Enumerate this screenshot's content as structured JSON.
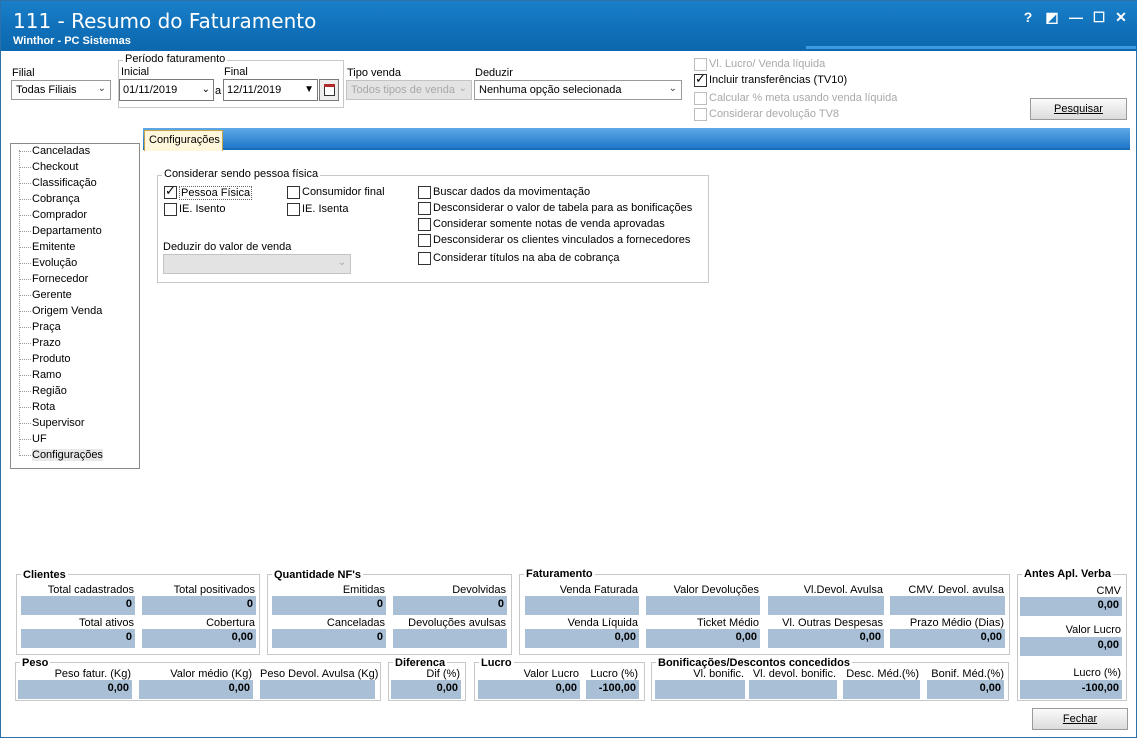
{
  "window": {
    "title": "111 - Resumo do Faturamento",
    "subtitle": "Winthor - PC Sistemas",
    "controls": [
      "?",
      "◩",
      "—",
      "☐",
      "✕"
    ]
  },
  "filters": {
    "filial_label": "Filial",
    "filial_value": "Todas Filiais",
    "periodo_label": "Período faturamento",
    "inicial_label": "Inicial",
    "inicial_value": "01/11/2019",
    "a_label": "a",
    "final_label": "Final",
    "final_value": "12/11/2019",
    "tipo_venda_label": "Tipo venda",
    "tipo_venda_value": "Todos tipos de venda",
    "deduzir_label": "Deduzir",
    "deduzir_value": "Nenhuma opção selecionada",
    "options": [
      {
        "label": "Vl. Lucro/ Venda líquida",
        "checked": false,
        "disabled": true
      },
      {
        "label": "Incluir transferências  (TV10)",
        "checked": true,
        "disabled": false
      },
      {
        "label": "Calcular % meta usando venda líquida",
        "checked": false,
        "disabled": true
      },
      {
        "label": "Considerar devolução TV8",
        "checked": false,
        "disabled": true
      }
    ],
    "pesquisar_button": "Pesquisar"
  },
  "tree": {
    "items": [
      "Canceladas",
      "Checkout",
      "Classificação",
      "Cobrança",
      "Comprador",
      "Departamento",
      "Emitente",
      "Evolução",
      "Fornecedor",
      "Gerente",
      "Origem Venda",
      "Praça",
      "Prazo",
      "Produto",
      "Ramo",
      "Região",
      "Rota",
      "Supervisor",
      "UF",
      "Configurações"
    ],
    "selected": "Configurações"
  },
  "config": {
    "tab_label": "Configurações",
    "group_title": "Considerar sendo pessoa física",
    "checks_left": [
      {
        "label": "Pessoa Física",
        "checked": true
      },
      {
        "label": "Consumidor final",
        "checked": false
      },
      {
        "label": "IE. Isento",
        "checked": false
      },
      {
        "label": "IE. Isenta",
        "checked": false
      }
    ],
    "checks_right": [
      {
        "label": "Buscar dados da movimentação",
        "checked": false
      },
      {
        "label": "Desconsiderar o valor de tabela para as bonificações",
        "checked": false
      },
      {
        "label": "Considerar somente notas de venda aprovadas",
        "checked": false
      },
      {
        "label": "Desconsiderar os clientes vinculados a fornecedores",
        "checked": false
      },
      {
        "label": "Considerar títulos na aba de cobrança",
        "checked": false
      }
    ],
    "deduzir_valor_label": "Deduzir do valor de venda",
    "deduzir_valor_value": ""
  },
  "summary": {
    "clientes": {
      "title": "Clientes",
      "fields": [
        {
          "label": "Total cadastrados",
          "value": "0"
        },
        {
          "label": "Total positivados",
          "value": "0"
        },
        {
          "label": "Total ativos",
          "value": "0"
        },
        {
          "label": "Cobertura",
          "value": "0,00"
        }
      ]
    },
    "quantidade": {
      "title": "Quantidade NF's",
      "fields": [
        {
          "label": "Emitidas",
          "value": "0"
        },
        {
          "label": "Devolvidas",
          "value": "0"
        },
        {
          "label": "Canceladas",
          "value": "0"
        },
        {
          "label": "Devoluções avulsas",
          "value": ""
        }
      ]
    },
    "faturamento": {
      "title": "Faturamento",
      "fields": [
        {
          "label": "Venda Faturada",
          "value": ""
        },
        {
          "label": "Valor Devoluções",
          "value": ""
        },
        {
          "label": "Vl.Devol. Avulsa",
          "value": ""
        },
        {
          "label": "CMV. Devol. avulsa",
          "value": ""
        },
        {
          "label": "Venda Líquida",
          "value": "0,00"
        },
        {
          "label": "Ticket Médio",
          "value": "0,00"
        },
        {
          "label": "Vl. Outras Despesas",
          "value": "0,00"
        },
        {
          "label": "Prazo Médio (Dias)",
          "value": "0,00"
        }
      ]
    },
    "antes": {
      "title": "Antes Apl. Verba",
      "fields": [
        {
          "label": "CMV",
          "value": "0,00"
        },
        {
          "label": "Valor Lucro",
          "value": "0,00"
        },
        {
          "label": "Lucro (%)",
          "value": "-100,00"
        }
      ]
    },
    "peso": {
      "title": "Peso",
      "fields": [
        {
          "label": "Peso fatur. (Kg)",
          "value": "0,00"
        },
        {
          "label": "Valor médio (Kg)",
          "value": "0,00"
        },
        {
          "label": "Peso Devol. Avulsa (Kg)",
          "value": ""
        }
      ]
    },
    "diferenca": {
      "title": "Diferenca",
      "fields": [
        {
          "label": "Dif (%)",
          "value": "0,00"
        }
      ]
    },
    "lucro": {
      "title": "Lucro",
      "fields": [
        {
          "label": "Valor Lucro",
          "value": "0,00"
        },
        {
          "label": "Lucro (%)",
          "value": "-100,00"
        }
      ]
    },
    "bonificacoes": {
      "title": "Bonificações/Descontos concedidos",
      "fields": [
        {
          "label": "Vl. bonific.",
          "value": ""
        },
        {
          "label": "Vl. devol. bonific.",
          "value": ""
        },
        {
          "label": "Desc. Méd.(%)",
          "value": ""
        },
        {
          "label": "Bonif. Méd.(%)",
          "value": "0,00"
        }
      ]
    }
  },
  "fechar_button": "Fechar"
}
